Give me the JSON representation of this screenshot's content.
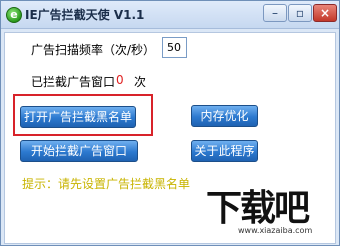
{
  "window": {
    "title": "IE广告拦截天使 V1.1",
    "app_icon": "e",
    "icons": {
      "app": "ie-logo-icon",
      "minimize": "minimize-icon",
      "maximize": "maximize-icon",
      "close": "close-icon"
    },
    "minimize_glyph": "–",
    "maximize_glyph": "▫",
    "close_glyph": "×"
  },
  "scan": {
    "frequency_label": "广告扫描频率（次/秒）",
    "frequency_value": "50"
  },
  "blocked": {
    "label": "已拦截广告窗口",
    "count": "0",
    "unit": "次",
    "count_color": "#e02020"
  },
  "buttons": {
    "open_blacklist": "打开广告拦截黑名单",
    "memory_optimize": "内存优化",
    "start_blocking": "开始拦截广告窗口",
    "about": "关于此程序"
  },
  "hint": "提示：请先设置广告拦截黑名单",
  "watermark": {
    "logo_text": "下载吧",
    "url": "www.xiazaiba.com"
  },
  "colors": {
    "highlight": "#d8232a",
    "button": "#2c79cf",
    "hint": "#c8b400"
  }
}
